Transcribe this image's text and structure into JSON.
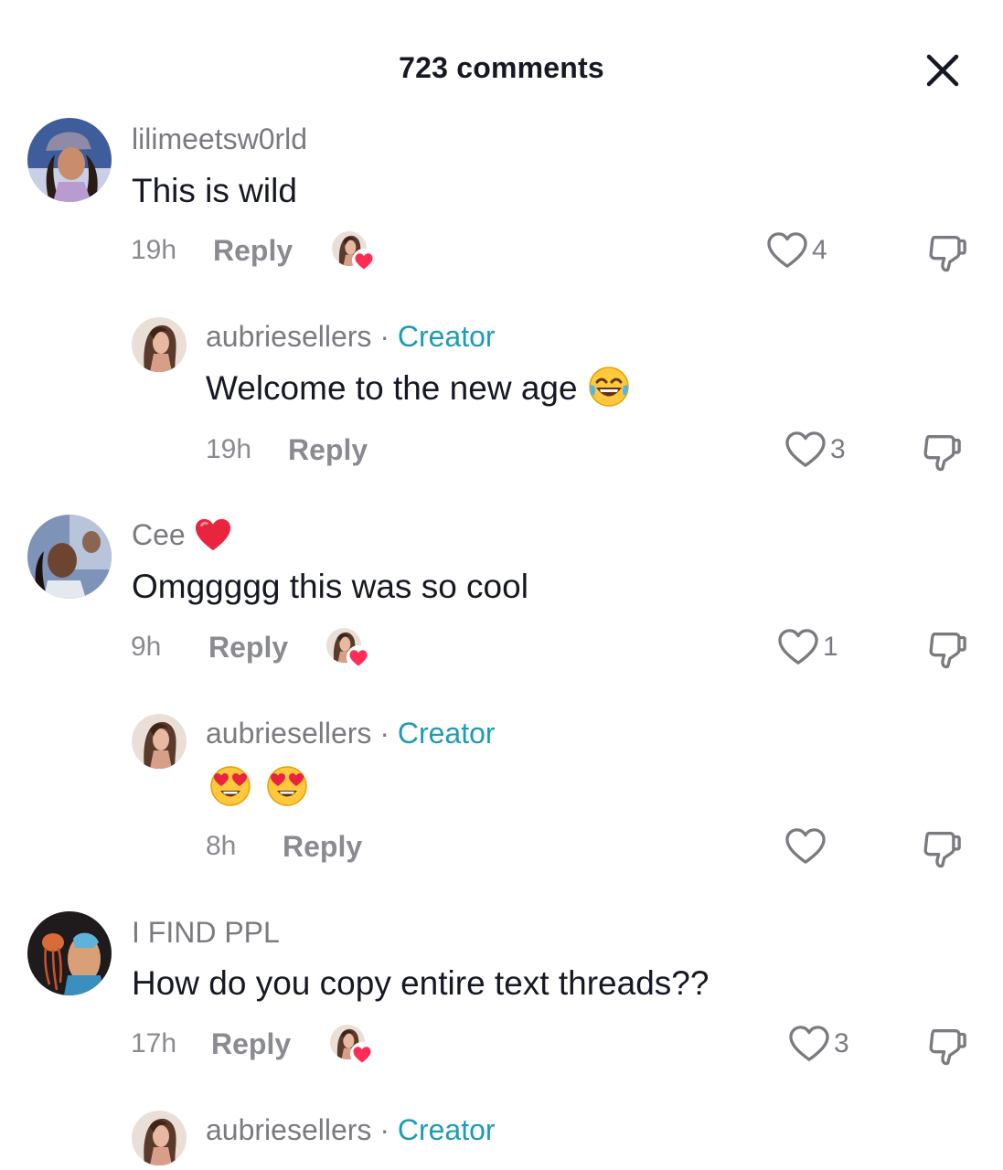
{
  "header": {
    "title": "723 comments",
    "close_icon": "close-icon"
  },
  "colors": {
    "creator": "#1e9bb5",
    "secondary_text": "#7a7b80",
    "heart_red": "#ff2c55"
  },
  "comments": [
    {
      "username": "lilimeetsw0rld",
      "text": "This is wild",
      "time": "19h",
      "reply_label": "Reply",
      "likes": "4",
      "liked_by_creator": true
    },
    {
      "username": "aubriesellers",
      "separator": "·",
      "badge": "Creator",
      "text": "Welcome to the new age",
      "emoji": "face-with-tears-of-joy",
      "time": "19h",
      "reply_label": "Reply",
      "likes": "3"
    },
    {
      "username": "Cee",
      "username_emoji": "red-heart",
      "text": "Omggggg this was so cool",
      "time": "9h",
      "reply_label": "Reply",
      "likes": "1",
      "liked_by_creator": true
    },
    {
      "username": "aubriesellers",
      "separator": "·",
      "badge": "Creator",
      "emoji": "smiling-face-with-heart-eyes",
      "time": "8h",
      "reply_label": "Reply",
      "likes": ""
    },
    {
      "username": "I FIND PPL",
      "text": "How do you copy entire text threads??",
      "time": "17h",
      "reply_label": "Reply",
      "likes": "3",
      "liked_by_creator": true
    },
    {
      "username": "aubriesellers",
      "separator": "·",
      "badge": "Creator"
    }
  ]
}
